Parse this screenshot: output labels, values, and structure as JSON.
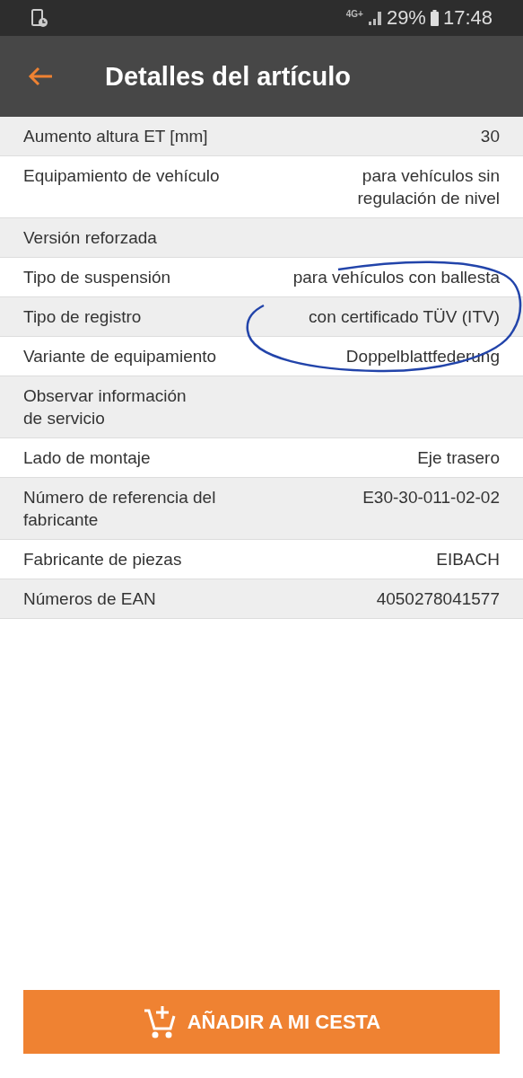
{
  "status_bar": {
    "network": "4G+",
    "battery": "29%",
    "time": "17:48"
  },
  "toolbar": {
    "title": "Detalles del artículo"
  },
  "attributes": [
    {
      "label": "Aumento altura ET [mm]",
      "value": "30"
    },
    {
      "label": "Equipamiento de vehículo",
      "value": "para vehículos sin\nregulación de nivel"
    },
    {
      "label": "Versión reforzada"
    },
    {
      "label": "Tipo de suspensión",
      "value": "para vehículos con ballesta"
    },
    {
      "label": "Tipo de registro",
      "value": "con certificado TÜV (ITV)"
    },
    {
      "label": "Variante de equipamiento",
      "value": "Doppelblattfederung"
    },
    {
      "label": "Observar información\nde servicio"
    },
    {
      "label": "Lado de montaje",
      "value": "Eje trasero"
    },
    {
      "label": "Número de referencia del\nfabricante",
      "value": "E30-30-011-02-02"
    },
    {
      "label": "Fabricante de piezas",
      "value": "EIBACH"
    },
    {
      "label": "Números de EAN",
      "value": "4050278041577"
    }
  ],
  "add_button": {
    "label": "AÑADIR A MI CESTA"
  }
}
